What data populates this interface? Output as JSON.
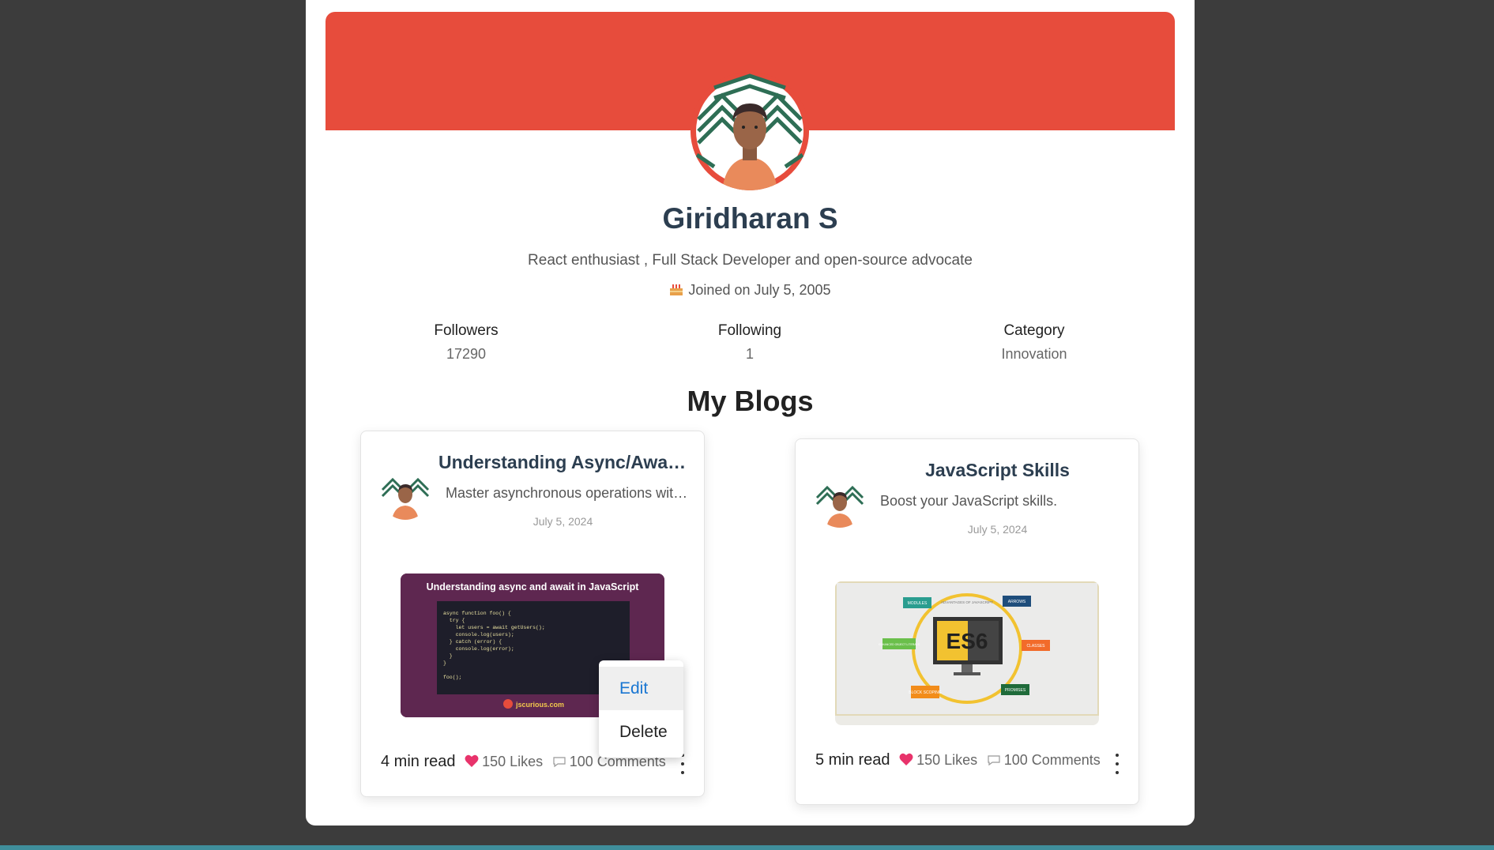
{
  "profile": {
    "name": "Giridharan S",
    "bio": "React enthusiast , Full Stack Developer and open-source advocate",
    "joined": "Joined on July 5, 2005",
    "banner_color": "#e74c3c"
  },
  "stats": [
    {
      "label": "Followers",
      "value": "17290"
    },
    {
      "label": "Following",
      "value": "1"
    },
    {
      "label": "Category",
      "value": "Innovation"
    }
  ],
  "blogs_heading": "My Blogs",
  "blogs": [
    {
      "title": "Understanding Async/Await in JavaScript",
      "description": "Master asynchronous operations with async/await",
      "date": "July 5, 2024",
      "read_time": "4 min read",
      "likes": "150 Likes",
      "comments": "100 Comments",
      "thumbnail": {
        "heading": "Understanding async and await in JavaScript",
        "code_lines": [
          "async function foo() {",
          "  try {",
          "    let users = await getUsers();",
          "    console.log(users);",
          "  } catch (error) {",
          "    console.log(error);",
          "  }",
          "}",
          "",
          "foo();"
        ],
        "footer": "jscurious.com"
      }
    },
    {
      "title": "JavaScript Skills",
      "description": "Boost your JavaScript skills.",
      "date": "July 5, 2024",
      "read_time": "5 min read",
      "likes": "150 Likes",
      "comments": "100 Comments",
      "thumbnail": {
        "center": "ES6",
        "subtitle": "ADVANTAGES OF JAVASCRIPT",
        "tags": [
          "MODULES",
          "ARROWS",
          "ENHANCED OBJECT LITERALS",
          "CLASSES",
          "BLOCK SCOPING",
          "PROMISES"
        ]
      }
    }
  ],
  "menu": {
    "edit": "Edit",
    "delete": "Delete"
  },
  "icons": {
    "joined": "cake-icon",
    "likes": "heart-icon",
    "comments": "comment-icon",
    "more": "more-vertical-icon"
  }
}
